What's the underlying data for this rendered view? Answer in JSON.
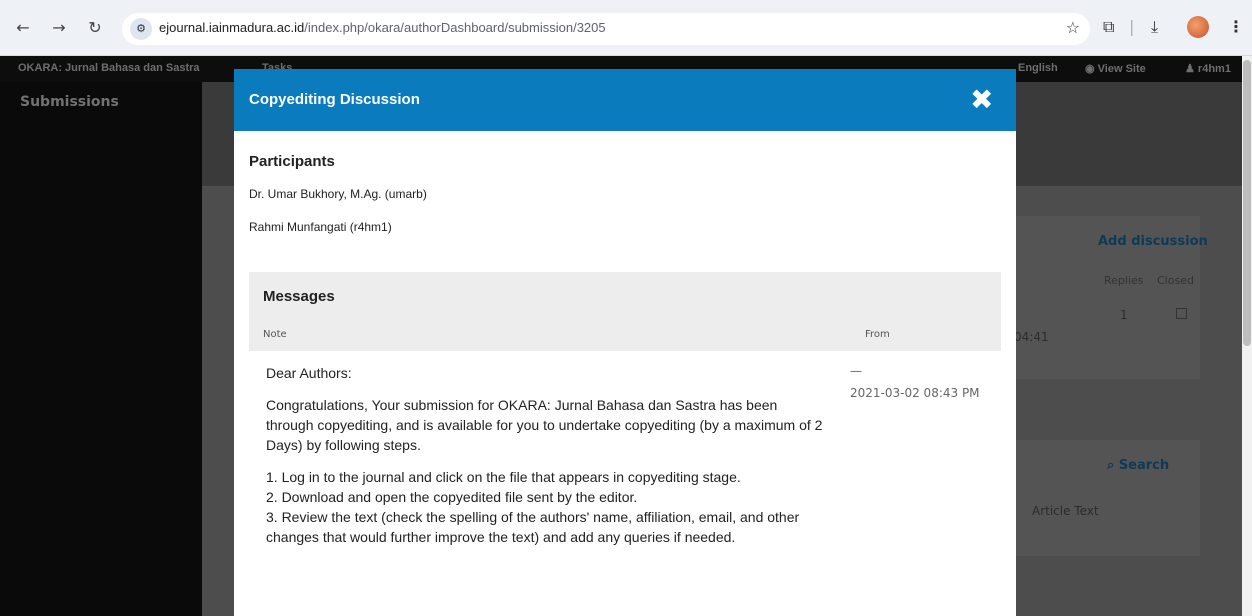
{
  "browser": {
    "url_host": "ejournal.iainmadura.ac.id",
    "url_path": "/index.php/okara/authorDashboard/submission/3205"
  },
  "app": {
    "journal_name": "OKARA: Jurnal Bahasa dan Sastra",
    "tasks_label": "Tasks",
    "language_label": "English",
    "view_site_label": "View Site",
    "user_label": "r4hm1",
    "sidebar_title": "Submissions",
    "add_discussion_label": "Add discussion",
    "replies_header": "Replies",
    "closed_header": "Closed",
    "replies_count": "1",
    "time_fragment": "04:41",
    "search_label": "Search",
    "article_text_label": "Article Text"
  },
  "modal": {
    "title": "Copyediting Discussion",
    "participants_title": "Participants",
    "participants": [
      "Dr. Umar Bukhory, M.Ag. (umarb)",
      "Rahmi Munfangati (r4hm1)"
    ],
    "messages_title": "Messages",
    "note_header": "Note",
    "from_header": "From",
    "message": {
      "greeting": "Dear Authors:",
      "intro": "Congratulations, Your submission for OKARA: Jurnal Bahasa dan Sastra has been through copyediting, and is available for you to undertake copyediting (by a maximum of 2 Days) by following steps.",
      "steps": [
        "1. Log in to the journal and click on the file that appears in copyediting stage.",
        "2. Download and open the copyedited file sent by the editor.",
        "3. Review the text (check the spelling of the authors' name, affiliation, email, and other changes that would further improve the text) and add any queries if needed."
      ],
      "from_name": "—",
      "date": "2021-03-02 08:43 PM"
    }
  },
  "colors": {
    "modal_header": "#0a7bbd",
    "link": "#006798"
  }
}
